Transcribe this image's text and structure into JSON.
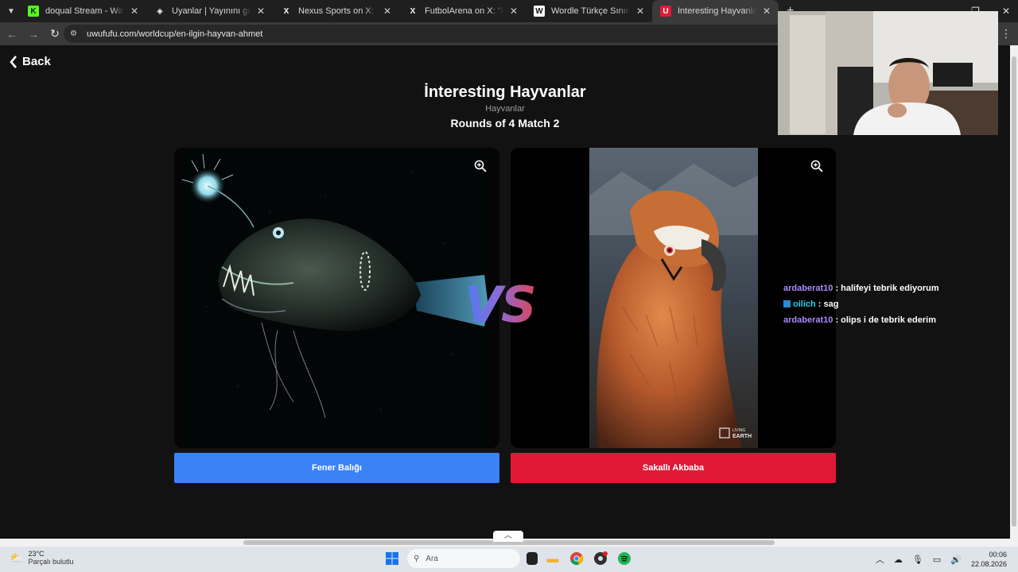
{
  "browser": {
    "tabs": [
      {
        "title": "doqual Stream - Watch Live on",
        "favicon": "kick-icon",
        "fav_color": "#53fc18",
        "fav_text": "K"
      },
      {
        "title": "Uyanlar | Yayınını güçlendirmek",
        "favicon": "diamond-icon",
        "fav_color": "#ffffff",
        "fav_text": "◈"
      },
      {
        "title": "Nexus Sports on X: \"",
        "favicon": "x-icon",
        "fav_color": "#ffffff",
        "fav_text": "X"
      },
      {
        "title": "FutbolArena on X: \"Premier Lig",
        "favicon": "x-icon",
        "fav_color": "#ffffff",
        "fav_text": "X"
      },
      {
        "title": "Wordle Türkçe Sınırsız - Beklem",
        "favicon": "wordle-icon",
        "fav_color": "#ffffff",
        "fav_text": "W"
      },
      {
        "title": "İnteresting Hayvanlar | UwUFU",
        "favicon": "uwufufu-icon",
        "fav_color": "#e11936",
        "fav_text": "U"
      }
    ],
    "url": "uwufufu.com/worldcup/en-ilgin-hayvan-ahmet"
  },
  "page": {
    "back_label": "Back",
    "title": "İnteresting Hayvanlar",
    "subtitle": "Hayvanlar",
    "round": "Rounds of 4 Match 2",
    "vs": "VS",
    "left_choice": "Fener Balığı",
    "right_choice": "Sakallı Akbaba",
    "watermark": "LIVING EARTH",
    "accent_left": "#3b82f6",
    "accent_right": "#e11936"
  },
  "chat": [
    {
      "user": "ardaberat10",
      "text": ": halifeyi tebrik ediyorum"
    },
    {
      "user": "oilich",
      "text": ": sag"
    },
    {
      "user": "ardaberat10",
      "text": ": olips i de tebrik ederim"
    }
  ],
  "taskbar": {
    "temp": "23°C",
    "condition": "Parçalı bulutlu",
    "search_placeholder": "Ara",
    "time": "00:06",
    "date": "22.08.2026"
  }
}
